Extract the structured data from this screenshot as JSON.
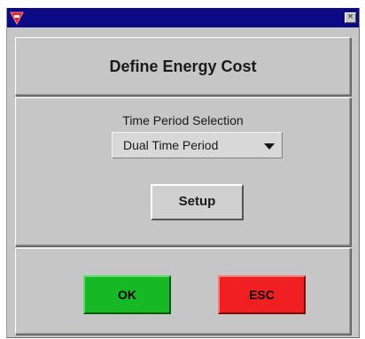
{
  "window": {
    "close_glyph": "×",
    "app_icon": "red-triangle-logo-icon",
    "title_bar_color": "#0a0a85"
  },
  "header": {
    "title": "Define Energy Cost"
  },
  "settings": {
    "time_period_label": "Time Period Selection",
    "time_period_value": "Dual Time Period",
    "setup_label": "Setup"
  },
  "actions": {
    "ok_label": "OK",
    "esc_label": "ESC"
  },
  "colors": {
    "panel_bg": "#c6c6c6",
    "ok_green": "#16b823",
    "esc_red": "#f02020"
  }
}
